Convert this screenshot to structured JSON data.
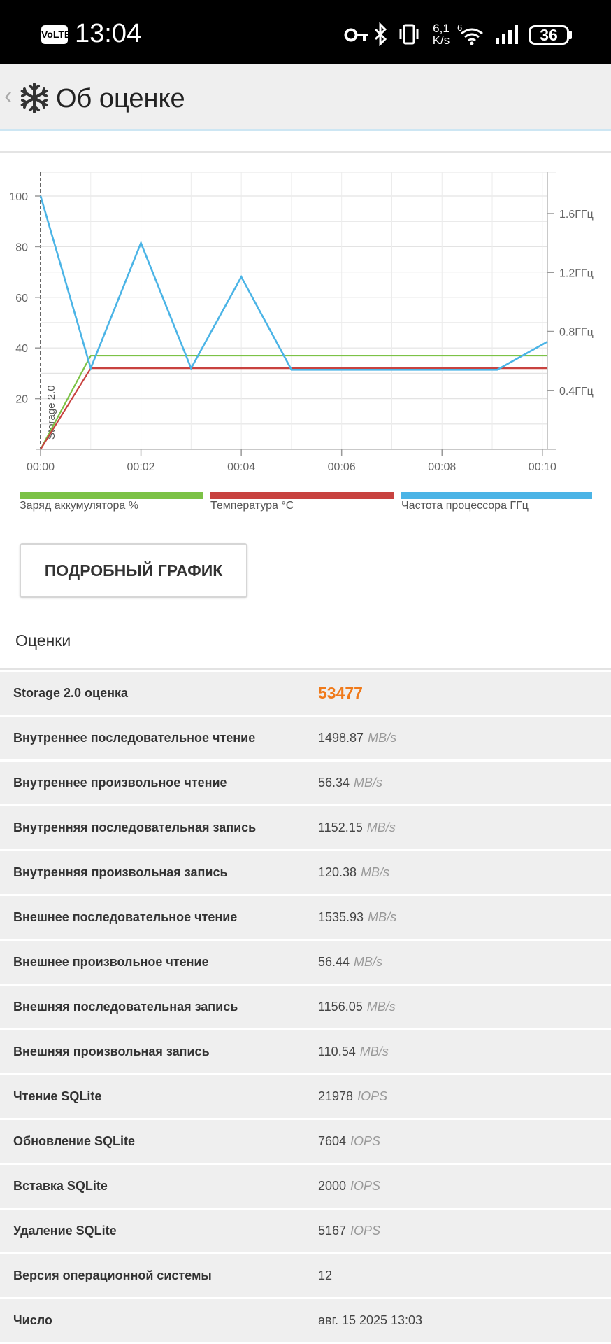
{
  "status_bar": {
    "volte": "VoLTE",
    "time": "13:04",
    "net_speed_value": "6,1",
    "net_speed_unit": "K/s",
    "battery": "36",
    "icons": [
      "key-icon",
      "bluetooth-icon",
      "vibrate-icon",
      "wifi-6-icon",
      "signal-icon",
      "battery-icon"
    ]
  },
  "app_bar": {
    "back_icon": "back-chevron-icon",
    "logo_icon": "snowflake-icon",
    "title": "Об оценке"
  },
  "colors": {
    "battery": "#7cc246",
    "temperature": "#c8423f",
    "cpu": "#4bb4e6",
    "score": "#f07a1a"
  },
  "chart_data": {
    "type": "line",
    "x_ticks": [
      "00:00",
      "00:02",
      "00:04",
      "00:06",
      "00:08",
      "00:10"
    ],
    "x_range_minutes": [
      0,
      10.1
    ],
    "y_left_ticks": [
      "20",
      "40",
      "60",
      "80",
      "100"
    ],
    "y_left_range": [
      0,
      110
    ],
    "y_right_ticks": [
      "0.4ГГц",
      "0.8ГГц",
      "1.2ГГц",
      "1.6ГГц"
    ],
    "y_right_range_ghz": [
      0,
      1.9
    ],
    "marker_label": "Storage 2.0",
    "grid": true,
    "legend_position": "bottom",
    "series": [
      {
        "name": "Заряд аккумулятора %",
        "axis": "left",
        "color": "#7cc246",
        "points": [
          [
            0,
            0
          ],
          [
            1,
            37
          ],
          [
            10.1,
            37
          ]
        ]
      },
      {
        "name": "Температура °C",
        "axis": "left",
        "color": "#c8423f",
        "points": [
          [
            0,
            0
          ],
          [
            1,
            32
          ],
          [
            10.1,
            32
          ]
        ]
      },
      {
        "name": "Частота процессора ГГц",
        "axis": "right",
        "color": "#4bb4e6",
        "points": [
          [
            0,
            1.72
          ],
          [
            1,
            0.55
          ],
          [
            2,
            1.4
          ],
          [
            3,
            0.55
          ],
          [
            4,
            1.17
          ],
          [
            5,
            0.54
          ],
          [
            9.1,
            0.54
          ],
          [
            10.1,
            0.73
          ]
        ]
      }
    ]
  },
  "detail_button": "ПОДРОБНЫЙ ГРАФИК",
  "scores": {
    "header": "Оценки",
    "rows": [
      {
        "label": "Storage 2.0 оценка",
        "value": "53477",
        "unit": "",
        "highlight": true
      },
      {
        "label": "Внутреннее последовательное чтение",
        "value": "1498.87",
        "unit": "MB/s"
      },
      {
        "label": "Внутреннее произвольное чтение",
        "value": "56.34",
        "unit": "MB/s"
      },
      {
        "label": "Внутренняя последовательная запись",
        "value": "1152.15",
        "unit": "MB/s"
      },
      {
        "label": "Внутренняя произвольная запись",
        "value": "120.38",
        "unit": "MB/s"
      },
      {
        "label": "Внешнее последовательное чтение",
        "value": "1535.93",
        "unit": "MB/s"
      },
      {
        "label": "Внешнее произвольное чтение",
        "value": "56.44",
        "unit": "MB/s"
      },
      {
        "label": "Внешняя последовательная запись",
        "value": "1156.05",
        "unit": "MB/s"
      },
      {
        "label": "Внешняя произвольная запись",
        "value": "110.54",
        "unit": "MB/s"
      },
      {
        "label": "Чтение SQLite",
        "value": "21978",
        "unit": "IOPS"
      },
      {
        "label": "Обновление SQLite",
        "value": "7604",
        "unit": "IOPS"
      },
      {
        "label": "Вставка SQLite",
        "value": "2000",
        "unit": "IOPS"
      },
      {
        "label": "Удаление SQLite",
        "value": "5167",
        "unit": "IOPS"
      },
      {
        "label": "Версия операционной системы",
        "value": "12",
        "unit": ""
      },
      {
        "label": "Число",
        "value": "авг. 15 2025 13:03",
        "unit": ""
      }
    ]
  }
}
